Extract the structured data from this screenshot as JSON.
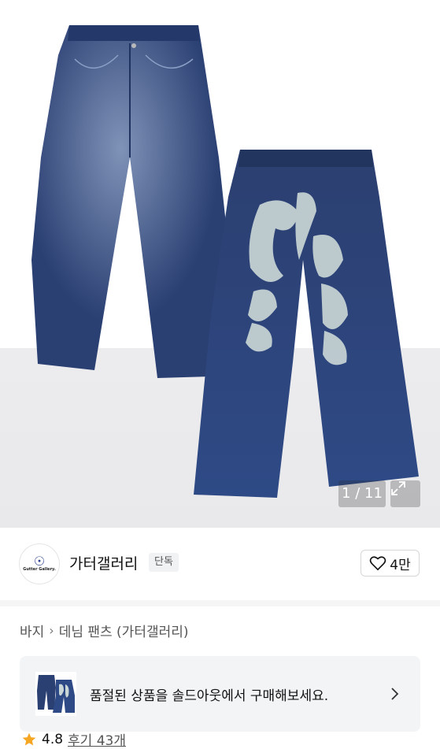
{
  "image_counter": "1 / 11",
  "brand": {
    "name": "가터갤러리",
    "badge": "단독",
    "logo_text": "Gutter Gallery."
  },
  "like": {
    "count": "4만"
  },
  "breadcrumb": {
    "category": "바지",
    "subcategory": "데님 팬츠 (가터갤러리)"
  },
  "soldout_banner": {
    "message": "품절된 상품을 솔드아웃에서 구매해보세요."
  },
  "rating": {
    "score": "4.8",
    "reviews": "후기 43개"
  },
  "colors": {
    "denim": "#2a3f72",
    "star": "#f5a623"
  }
}
